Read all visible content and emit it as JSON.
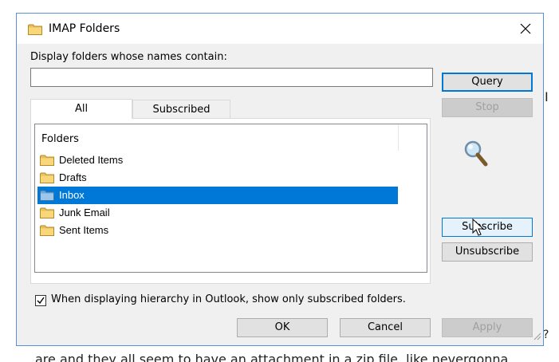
{
  "background": {
    "glyph_right": "I",
    "glyph_question": "?",
    "bottom_text": "are and they all seem to have an attachment in a zip file, like nevergonna..."
  },
  "dialog": {
    "title": "IMAP Folders",
    "title_icon": "folder-icon",
    "close_glyph": "close-icon"
  },
  "filter": {
    "label": "Display folders whose names contain:",
    "value": "",
    "placeholder": ""
  },
  "buttons": {
    "query": "Query",
    "stop": "Stop",
    "subscribe": "Subscribe",
    "unsubscribe": "Unsubscribe",
    "ok": "OK",
    "cancel": "Cancel",
    "apply": "Apply"
  },
  "tabs": [
    {
      "label": "All",
      "active": true
    },
    {
      "label": "Subscribed",
      "active": false
    }
  ],
  "list": {
    "header": "Folders",
    "items": [
      {
        "label": "Deleted Items",
        "selected": false
      },
      {
        "label": "Drafts",
        "selected": false
      },
      {
        "label": "Inbox",
        "selected": true
      },
      {
        "label": "Junk Email",
        "selected": false
      },
      {
        "label": "Sent Items",
        "selected": false
      }
    ]
  },
  "hierarchy_option": {
    "label": "When displaying hierarchy in Outlook, show only subscribed folders.",
    "checked": true
  },
  "colors": {
    "accent": "#0078d7",
    "dialog_bg": "#f0f0f0",
    "folder_yellow": "#e8c05a"
  }
}
